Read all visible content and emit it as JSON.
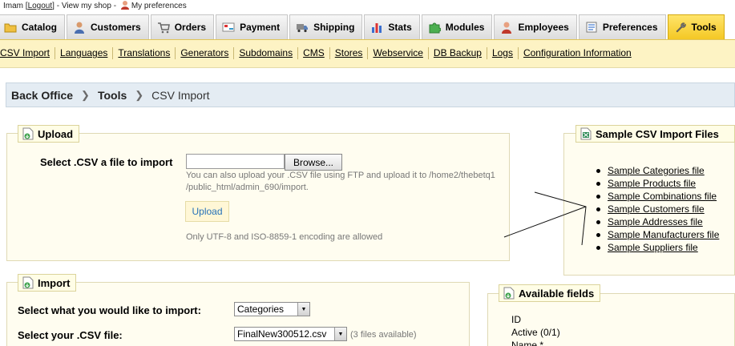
{
  "userbar": {
    "user": "Imam [",
    "logout": "Logout",
    "sep1": "] -",
    "view_shop": "View my shop",
    "sep2": "-",
    "preferences": "My preferences"
  },
  "tabs": [
    {
      "label": "Catalog",
      "icon": "folder-icon"
    },
    {
      "label": "Customers",
      "icon": "customer-icon"
    },
    {
      "label": "Orders",
      "icon": "cart-icon"
    },
    {
      "label": "Payment",
      "icon": "payment-icon"
    },
    {
      "label": "Shipping",
      "icon": "truck-icon"
    },
    {
      "label": "Stats",
      "icon": "stats-icon"
    },
    {
      "label": "Modules",
      "icon": "puzzle-icon"
    },
    {
      "label": "Employees",
      "icon": "employee-icon"
    },
    {
      "label": "Preferences",
      "icon": "preferences-icon"
    },
    {
      "label": "Tools",
      "icon": "wrench-icon",
      "active": true
    }
  ],
  "submenu": [
    "CSV Import",
    "Languages",
    "Translations",
    "Generators",
    "Subdomains",
    "CMS",
    "Stores",
    "Webservice",
    "DB Backup",
    "Logs",
    "Configuration Information"
  ],
  "breadcrumb": {
    "root": "Back Office",
    "section": "Tools",
    "current": "CSV Import"
  },
  "upload": {
    "legend": "Upload",
    "select_label": "Select .CSV a file to import",
    "browse": "Browse...",
    "hint_line1": "You can also upload your .CSV file using FTP and upload it to /home2/thebetq1",
    "hint_line2": "/public_html/admin_690/import.",
    "upload_button": "Upload",
    "encoding_note": "Only UTF-8 and ISO-8859-1 encoding are allowed"
  },
  "samples": {
    "legend": "Sample CSV Import Files",
    "files": [
      "Sample Categories file",
      "Sample Products file",
      "Sample Combinations file",
      "Sample Customers file",
      "Sample Addresses file",
      "Sample Manufacturers file",
      "Sample Suppliers file"
    ]
  },
  "import": {
    "legend": "Import",
    "what_label": "Select what you would like to import:",
    "what_value": "Categories",
    "csv_label": "Select your .CSV file:",
    "csv_value": "FinalNew300512.csv",
    "files_count": "(3 files available)"
  },
  "available": {
    "legend": "Available fields",
    "fields": [
      "ID",
      "Active (0/1)",
      "Name *"
    ]
  },
  "colors": {
    "active_tab": "#f4c824",
    "submenu_bg": "#fdf3c4",
    "panel_bg": "#fffdf0",
    "link_blue": "#2672b8"
  }
}
